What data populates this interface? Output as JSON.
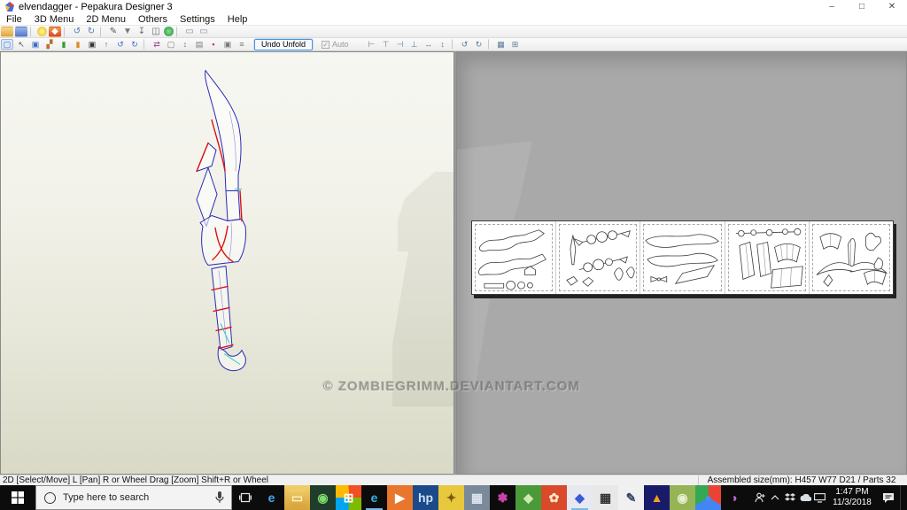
{
  "window": {
    "title": "elvendagger - Pepakura Designer 3",
    "minimize_glyph": "–",
    "maximize_glyph": "□",
    "close_glyph": "✕"
  },
  "menu": {
    "items": [
      "File",
      "3D Menu",
      "2D Menu",
      "Others",
      "Settings",
      "Help"
    ]
  },
  "toolbar1": {
    "icons": [
      {
        "name": "open-file-icon",
        "glyph": "",
        "bg": "linear-gradient(#f7d98a,#dfa53f)"
      },
      {
        "name": "save-icon",
        "glyph": "",
        "bg": "linear-gradient(#9db8e8,#5577c8)"
      },
      {
        "name": "separator",
        "state": "sep"
      },
      {
        "name": "light-bulb-icon",
        "glyph": "",
        "bg": "radial-gradient(#fff6a8,#f0c020)",
        "state": "circle"
      },
      {
        "name": "textured-view-icon",
        "glyph": "◆",
        "fg": "#ffffff",
        "bg": "linear-gradient(#f0a040,#d84830)"
      },
      {
        "name": "separator",
        "state": "sep"
      },
      {
        "name": "undo-icon",
        "glyph": "↺",
        "fg": "#4a7ab8"
      },
      {
        "name": "redo-icon",
        "glyph": "↻",
        "fg": "#4a7ab8"
      },
      {
        "name": "separator",
        "state": "sep"
      },
      {
        "name": "pen-tool-icon",
        "glyph": "✎",
        "fg": "#555555"
      },
      {
        "name": "stamp-tool-icon",
        "glyph": "▼",
        "fg": "#777777"
      },
      {
        "name": "anchor-tool-icon",
        "glyph": "↧",
        "fg": "#666666"
      },
      {
        "name": "box-tool-icon",
        "glyph": "◫",
        "fg": "#666666"
      },
      {
        "name": "globe-icon",
        "glyph": "",
        "bg": "radial-gradient(#8ae08a,#2a9a4a)",
        "state": "circle"
      },
      {
        "name": "separator",
        "state": "sep"
      },
      {
        "name": "layout-3d-window-icon",
        "glyph": "▭",
        "fg": "#8888aa"
      },
      {
        "name": "layout-2d-window-icon",
        "glyph": "▭",
        "fg": "#8888aa"
      }
    ]
  },
  "toolbar2": {
    "undo_unfold_label": "Undo Unfold",
    "auto_label": "Auto",
    "auto_check_glyph": "✓",
    "icons": [
      {
        "name": "select-move-tool-icon",
        "glyph": "▢",
        "fg": "#3a6ac8",
        "state": "pressed"
      },
      {
        "name": "pointer-tool-icon",
        "glyph": "↖",
        "fg": "#555555"
      },
      {
        "name": "display-settings-icon",
        "glyph": "▣",
        "fg": "#3a6ac8"
      },
      {
        "name": "unfold-steps-icon",
        "glyph": "▞",
        "fg": "#c06a2a"
      },
      {
        "name": "edge-color-green-icon",
        "glyph": "▮",
        "fg": "#3a9a3a"
      },
      {
        "name": "edge-color-orange-icon",
        "glyph": "▮",
        "fg": "#e08a2a"
      },
      {
        "name": "dark-view-icon",
        "glyph": "▣",
        "fg": "#333333"
      },
      {
        "name": "pick-part-icon",
        "glyph": "↑",
        "fg": "#8a5a2a"
      },
      {
        "name": "rotate-view-ccw-icon",
        "glyph": "↺",
        "fg": "#3a6ac8"
      },
      {
        "name": "rotate-view-cw-icon",
        "glyph": "↻",
        "fg": "#3a6ac8"
      },
      {
        "name": "separator",
        "state": "sep"
      },
      {
        "name": "flip-part-icon",
        "glyph": "⇄",
        "fg": "#9a4a9a"
      },
      {
        "name": "marquee-select-icon",
        "glyph": "▢",
        "fg": "#777777"
      },
      {
        "name": "scale-parts-icon",
        "glyph": "↕",
        "fg": "#777777"
      },
      {
        "name": "sheet-settings-icon",
        "glyph": "▤",
        "fg": "#777777"
      },
      {
        "name": "save-pattern-icon",
        "glyph": "▪",
        "fg": "#c03a3a"
      },
      {
        "name": "preview-sheet-icon",
        "glyph": "▣",
        "fg": "#777777"
      },
      {
        "name": "print-layout-icon",
        "glyph": "≡",
        "fg": "#777777"
      }
    ],
    "align_icons": [
      {
        "name": "align-left-icon",
        "glyph": "⊢"
      },
      {
        "name": "align-top-icon",
        "glyph": "⊤"
      },
      {
        "name": "align-right-icon",
        "glyph": "⊣"
      },
      {
        "name": "align-bottom-icon",
        "glyph": "⊥"
      },
      {
        "name": "distribute-horizontal-icon",
        "glyph": "↔"
      },
      {
        "name": "distribute-vertical-icon",
        "glyph": "↕"
      },
      {
        "name": "separator",
        "state": "sep"
      },
      {
        "name": "rotate-part-ccw-icon",
        "glyph": "↺"
      },
      {
        "name": "rotate-part-cw-icon",
        "glyph": "↻"
      },
      {
        "name": "separator",
        "state": "sep"
      },
      {
        "name": "arrange-parts-icon",
        "glyph": "▦"
      },
      {
        "name": "reset-layout-icon",
        "glyph": "⊞"
      }
    ]
  },
  "viewport": {
    "watermark_text": "© ZOMBIEGRIMM.DEVIANTART.COM",
    "model_name": "elven dagger 3D wireframe",
    "page_count": 5
  },
  "status_bar": {
    "left": "2D [Select/Move] L [Pan] R or Wheel Drag [Zoom] Shift+R or Wheel",
    "right": "Assembled size(mm): H457 W77 D21 / Parts 32"
  },
  "taskbar": {
    "search_placeholder": "Type here to search",
    "clock": {
      "time": "1:47 PM",
      "date": "11/3/2018"
    },
    "apps": [
      {
        "name": "taskbar-app-edge",
        "glyph": "e",
        "fg": "#45a8e8"
      },
      {
        "name": "taskbar-app-file-explorer",
        "glyph": "▭",
        "fg": "#fff0c8",
        "bg": "linear-gradient(#f2cf6b,#d7a43b)"
      },
      {
        "name": "taskbar-app-green-utility",
        "glyph": "◉",
        "fg": "#7ddc6a",
        "bg": "#1f3d2a",
        "state": "circle"
      },
      {
        "name": "taskbar-app-microsoft-store",
        "glyph": "⊞",
        "fg": "#ffffff",
        "bg": "conic-gradient(#f25022 0 90deg,#7fba00 90deg 180deg,#00a4ef 180deg 270deg,#ffb900 270deg)"
      },
      {
        "name": "taskbar-app-internet-explorer",
        "glyph": "e",
        "fg": "#35b4e3",
        "state": "running"
      },
      {
        "name": "taskbar-app-media-player-orange",
        "glyph": "▶",
        "fg": "#ffffff",
        "bg": "#e8762c",
        "state": "circle"
      },
      {
        "name": "taskbar-app-hp-tool",
        "glyph": "hp",
        "fg": "#cfe0f5",
        "bg": "#1a4a8a",
        "state": "circle"
      },
      {
        "name": "taskbar-app-photo-viewer",
        "glyph": "✦",
        "fg": "#7a5a10",
        "bg": "#e8c83c"
      },
      {
        "name": "taskbar-app-media-player-classic",
        "glyph": "▦",
        "fg": "#dde4ee",
        "bg": "#7a8a9a"
      },
      {
        "name": "taskbar-app-share-molecule",
        "glyph": "✽",
        "fg": "#cc44aa"
      },
      {
        "name": "taskbar-app-green-map",
        "glyph": "◆",
        "fg": "#cfe8b0",
        "bg": "#4a9a3a"
      },
      {
        "name": "taskbar-app-red-flower",
        "glyph": "✿",
        "fg": "#ffe8c8",
        "bg": "#d84a2a",
        "state": "circle"
      },
      {
        "name": "taskbar-app-pepakura-designer",
        "glyph": "◆",
        "fg": "#3a5ad8",
        "bg": "#e8e8f0",
        "state": "active running"
      },
      {
        "name": "taskbar-app-calculator",
        "glyph": "▦",
        "fg": "#333333",
        "bg": "#e8e8e8"
      },
      {
        "name": "taskbar-app-notepad",
        "glyph": "✎",
        "fg": "#334466",
        "bg": "#f0f0f0"
      },
      {
        "name": "taskbar-app-blue-dome",
        "glyph": "▲",
        "fg": "#f0a020",
        "bg": "#1a1a6a"
      },
      {
        "name": "taskbar-app-openoffice",
        "glyph": "◉",
        "fg": "#e8f0d0",
        "bg": "#95b455",
        "state": "circle"
      },
      {
        "name": "taskbar-app-chrome",
        "glyph": "●",
        "fg": "#4a90e8",
        "bg": "conic-gradient(#ea4335 0 120deg,#4285f4 120deg 240deg,#34a853 240deg)",
        "state": "circle"
      },
      {
        "name": "taskbar-app-paint3d",
        "glyph": "◑",
        "fg": "#b868d8"
      }
    ]
  }
}
